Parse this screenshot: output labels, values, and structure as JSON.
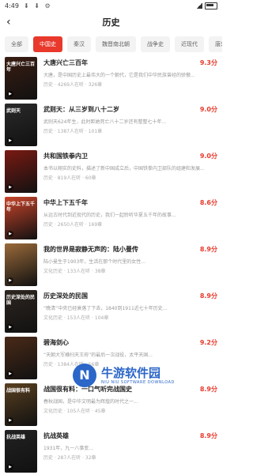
{
  "status": {
    "time": "4:49",
    "icons": "⬇ ⬇ ⚙"
  },
  "header": {
    "back": "‹",
    "title": "历史"
  },
  "tabs": [
    "全部",
    "中国史",
    "秦汉",
    "魏晋南北朝",
    "战争史",
    "近现代",
    "唐宋"
  ],
  "active_tab_index": 1,
  "books": [
    {
      "title": "大唐兴亡三百年",
      "score": "9.3分",
      "desc": "大唐，是中国历史上最伟大的一个朝代，它是我们中华民族曾经的骄傲...",
      "meta": "历史 · 4269人在听 · 326章",
      "cover_text": "大唐兴亡三百年",
      "cover_color": "#3a1d12"
    },
    {
      "title": "武则天：从三岁到八十二岁",
      "score": "9.0分",
      "desc": "武则天624年生，此时距她死亡八十二岁还有整整七十年...",
      "meta": "历史 · 1387人在听 · 101章",
      "cover_text": "武则天",
      "cover_color": "#2a2a2a"
    },
    {
      "title": "共和国铁拳内卫",
      "score": "9.0分",
      "desc": "本书以翔实的史料，描述了新中国成立后，中国铁拳内卫部队的组建和发展...",
      "meta": "历史 · 819人在听 · 60章",
      "cover_text": "",
      "cover_color": "#7a1a12"
    },
    {
      "title": "中华上下五千年",
      "score": "8.6分",
      "desc": "从远古时代到近现代的历史，我们一起聆听华夏五千年的故事...",
      "meta": "历史 · 2650人在听 · 169章",
      "cover_text": "中华上下五千年",
      "cover_color": "#c9442a"
    },
    {
      "title": "我的世界是寂静无声的：陆小曼传",
      "score": "8.9分",
      "desc": "陆小曼生于1903年，生活在那个时代里的女性...",
      "meta": "文化历史 · 133人在听 · 38章",
      "cover_text": "",
      "cover_color": "#9a6a3a"
    },
    {
      "title": "历史深处的民国",
      "score": "8.9分",
      "desc": "“晚清”中央已经衰落了下去，1840到1911近七十年历史...",
      "meta": "文化历史 · 153人在听 · 104章",
      "cover_text": "历史深处的民国",
      "cover_color": "#2e2620"
    },
    {
      "title": "碧海剑心",
      "score": "9.2分",
      "desc": "“天朝大军横扫天王府”的最后一次战役，太平天国...",
      "meta": "历史 · 1384人在听 · 56章",
      "cover_text": "",
      "cover_color": "#4a2a18"
    },
    {
      "title": "战国很有料：一口气听完战国史",
      "score": "8.9分",
      "desc": "春秋战国，是中华文明最为辉煌的时代之一...",
      "meta": "文化历史 · 105人在听 · 45章",
      "cover_text": "战国很有料",
      "cover_color": "#5a4020"
    },
    {
      "title": "抗战英雄",
      "score": "8.9分",
      "desc": "1931年，九一八事变...",
      "meta": "历史 · 287人在听 · 32章",
      "cover_text": "抗战英雄",
      "cover_color": "#222222"
    }
  ],
  "watermark": {
    "logo": "N",
    "title": "牛游软件园",
    "subtitle": "NIU NIU SOFTWARE DOWNLOAD"
  }
}
